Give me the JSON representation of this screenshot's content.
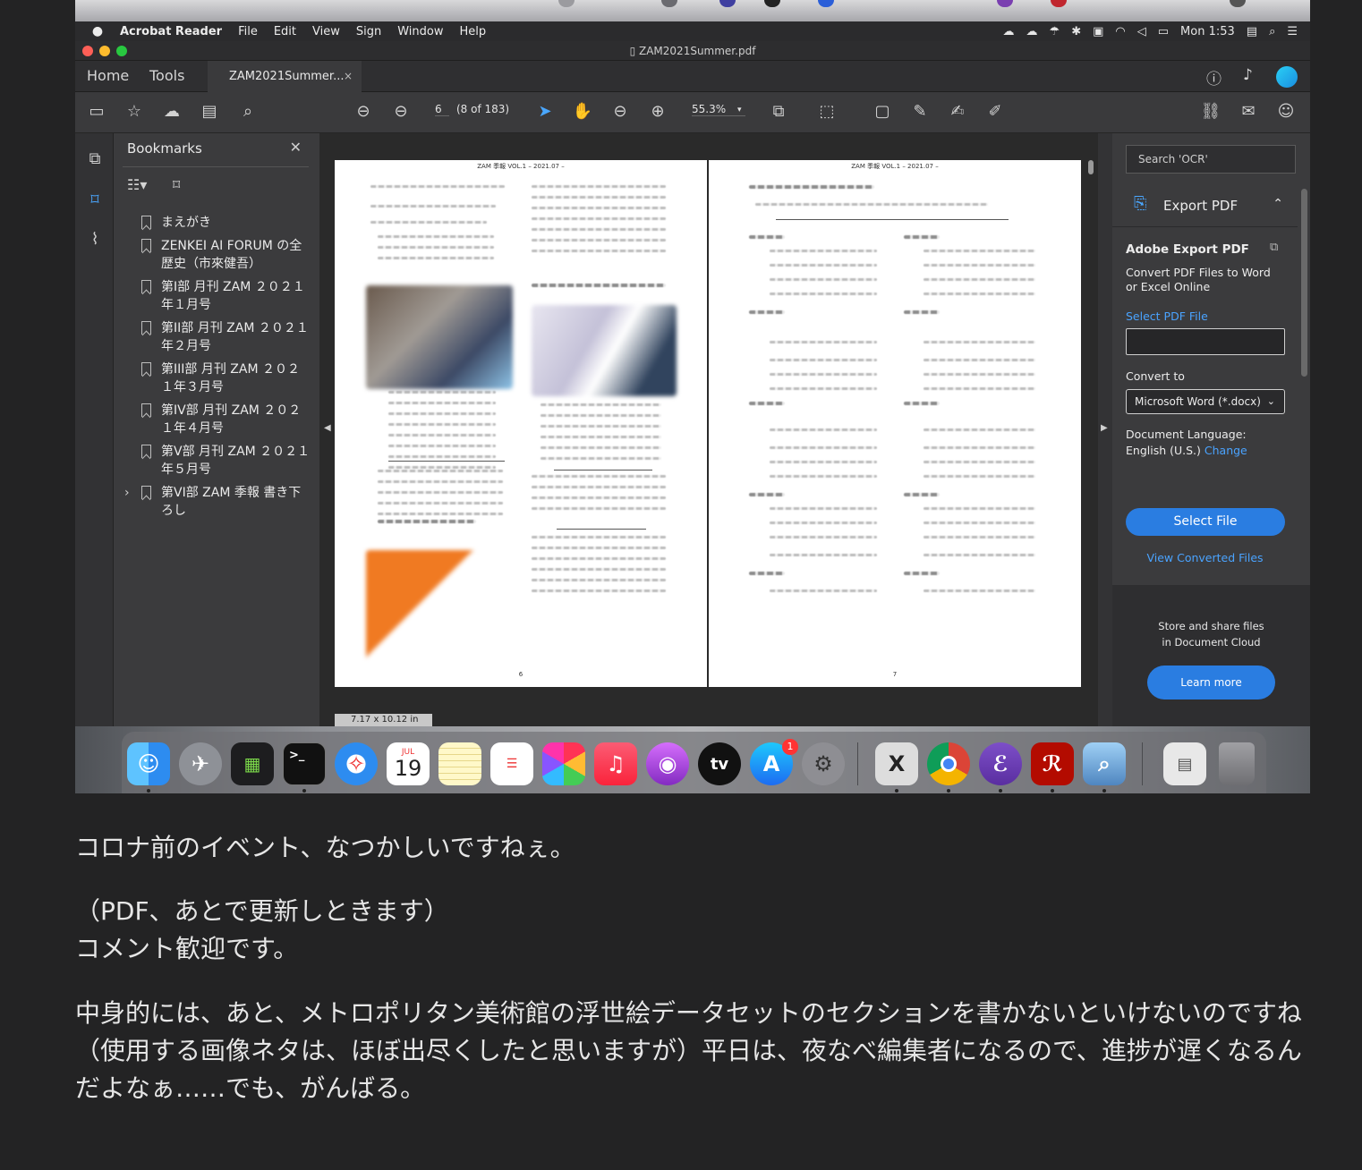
{
  "menubar": {
    "app": "Acrobat Reader",
    "items": [
      "File",
      "Edit",
      "View",
      "Sign",
      "Window",
      "Help"
    ],
    "clock": "Mon 1:53"
  },
  "window": {
    "title": "ZAM2021Summer.pdf"
  },
  "tabs": {
    "home": "Home",
    "tools": "Tools",
    "doc": "ZAM2021Summer...",
    "close": "×"
  },
  "toolbar": {
    "page_current": "6",
    "page_of": "(8 of 183)",
    "zoom": "55.3%"
  },
  "bookmarks": {
    "title": "Bookmarks",
    "items": [
      {
        "label": "まえがき"
      },
      {
        "label": "ZENKEI AI FORUM の全歴史（市來健吾）"
      },
      {
        "label": "第I部 月刊 ZAM ２０２１年１月号"
      },
      {
        "label": "第II部 月刊 ZAM ２０２１年２月号"
      },
      {
        "label": "第III部 月刊 ZAM ２０２１年３月号"
      },
      {
        "label": "第IV部 月刊 ZAM ２０２１年４月号"
      },
      {
        "label": "第V部 月刊 ZAM ２０２１年５月号"
      },
      {
        "label": "第VI部 ZAM 季報 書き下ろし"
      }
    ]
  },
  "pages": {
    "left_header": "ZAM 季報 VOL.1 – 2021.07 –",
    "right_header": "ZAM 季報 VOL.1 – 2021.07 –",
    "left_number": "6",
    "right_number": "7",
    "page_size": "7.17 x 10.12 in"
  },
  "right_panel": {
    "search_placeholder": "Search 'OCR'",
    "export_label": "Export PDF",
    "heading": "Adobe Export PDF",
    "desc_line1": "Convert PDF Files to Word",
    "desc_line2": "or Excel Online",
    "select_pdf": "Select PDF File",
    "convert_to": "Convert to",
    "format": "Microsoft Word (*.docx)",
    "doc_language": "Document Language:",
    "language": "English (U.S.)",
    "change": "Change",
    "select_file": "Select File",
    "view_converted": "View Converted Files",
    "store_line1": "Store and share files",
    "store_line2": "in Document Cloud",
    "learn_more": "Learn more"
  },
  "dock": {
    "calendar_month": "JUL",
    "calendar_day": "19",
    "appstore_badge": "1",
    "tv_label": "tv"
  },
  "article": {
    "p1": "コロナ前のイベント、なつかしいですねぇ。",
    "p2_line1": "（PDF、あとで更新しときます）",
    "p2_line2": "コメント歓迎です。",
    "p3": "中身的には、あと、メトロポリタン美術館の浮世絵データセットのセクションを書かないといけないのですね（使用する画像ネタは、ほぼ出尽くしたと思いますが）平日は、夜なべ編集者になるので、進捗が遅くなるんだよなぁ……でも、がんばる。"
  }
}
